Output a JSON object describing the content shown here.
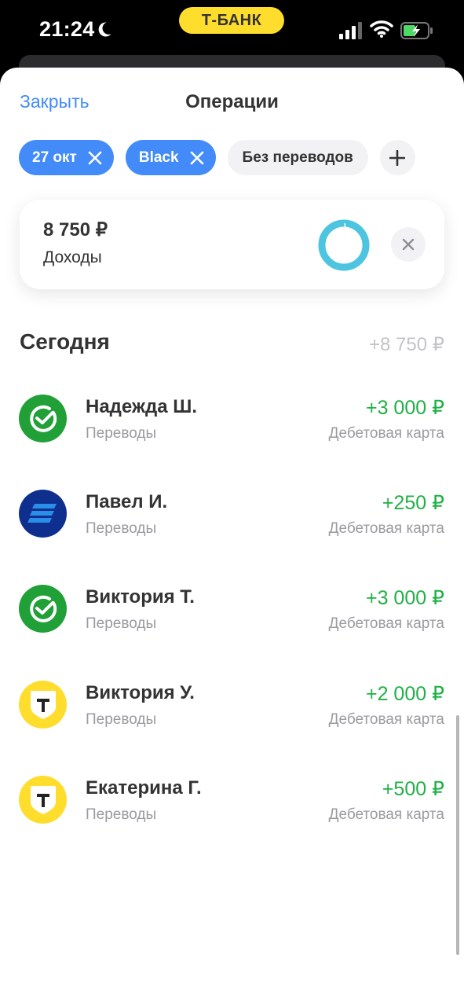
{
  "status_bar": {
    "time": "21:24",
    "brand": "Т-БАНК"
  },
  "header": {
    "close_label": "Закрыть",
    "title": "Операции"
  },
  "filters": {
    "chips": [
      {
        "label": "27 окт",
        "active": true
      },
      {
        "label": "Black",
        "active": true
      },
      {
        "label": "Без переводов",
        "active": false
      }
    ],
    "add_icon": "plus-icon"
  },
  "summary": {
    "amount": "8 750 ₽",
    "label": "Доходы",
    "donut_color": "#4dc4e0"
  },
  "section": {
    "title": "Сегодня",
    "total": "+8 750 ₽"
  },
  "operations": [
    {
      "name": "Надежда Ш.",
      "category": "Переводы",
      "amount": "+3 000 ₽",
      "account": "Дебетовая карта",
      "icon": "sber-icon"
    },
    {
      "name": "Павел И.",
      "category": "Переводы",
      "amount": "+250 ₽",
      "account": "Дебетовая карта",
      "icon": "vtb-icon"
    },
    {
      "name": "Виктория Т.",
      "category": "Переводы",
      "amount": "+3 000 ₽",
      "account": "Дебетовая карта",
      "icon": "sber-icon"
    },
    {
      "name": "Виктория У.",
      "category": "Переводы",
      "amount": "+2 000 ₽",
      "account": "Дебетовая карта",
      "icon": "tbank-icon"
    },
    {
      "name": "Екатерина Г.",
      "category": "Переводы",
      "amount": "+500 ₽",
      "account": "Дебетовая карта",
      "icon": "tbank-icon"
    }
  ],
  "colors": {
    "accent": "#428bf9",
    "income": "#1fb045",
    "brand_yellow": "#ffdd2d",
    "sber_green": "#21a038",
    "vtb_blue": "#0f2f8f"
  }
}
